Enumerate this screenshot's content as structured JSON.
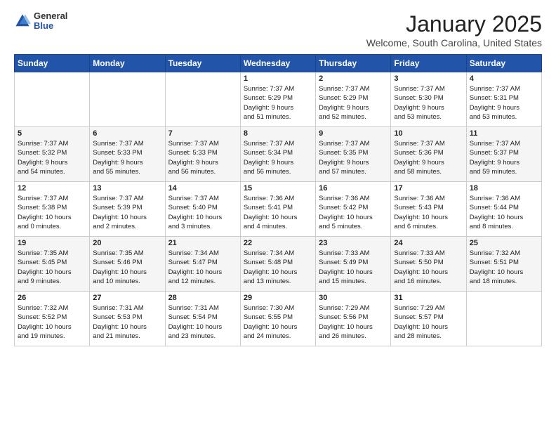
{
  "logo": {
    "general": "General",
    "blue": "Blue"
  },
  "title": "January 2025",
  "subtitle": "Welcome, South Carolina, United States",
  "headers": [
    "Sunday",
    "Monday",
    "Tuesday",
    "Wednesday",
    "Thursday",
    "Friday",
    "Saturday"
  ],
  "weeks": [
    [
      {
        "day": "",
        "info": ""
      },
      {
        "day": "",
        "info": ""
      },
      {
        "day": "",
        "info": ""
      },
      {
        "day": "1",
        "info": "Sunrise: 7:37 AM\nSunset: 5:29 PM\nDaylight: 9 hours\nand 51 minutes."
      },
      {
        "day": "2",
        "info": "Sunrise: 7:37 AM\nSunset: 5:29 PM\nDaylight: 9 hours\nand 52 minutes."
      },
      {
        "day": "3",
        "info": "Sunrise: 7:37 AM\nSunset: 5:30 PM\nDaylight: 9 hours\nand 53 minutes."
      },
      {
        "day": "4",
        "info": "Sunrise: 7:37 AM\nSunset: 5:31 PM\nDaylight: 9 hours\nand 53 minutes."
      }
    ],
    [
      {
        "day": "5",
        "info": "Sunrise: 7:37 AM\nSunset: 5:32 PM\nDaylight: 9 hours\nand 54 minutes."
      },
      {
        "day": "6",
        "info": "Sunrise: 7:37 AM\nSunset: 5:33 PM\nDaylight: 9 hours\nand 55 minutes."
      },
      {
        "day": "7",
        "info": "Sunrise: 7:37 AM\nSunset: 5:33 PM\nDaylight: 9 hours\nand 56 minutes."
      },
      {
        "day": "8",
        "info": "Sunrise: 7:37 AM\nSunset: 5:34 PM\nDaylight: 9 hours\nand 56 minutes."
      },
      {
        "day": "9",
        "info": "Sunrise: 7:37 AM\nSunset: 5:35 PM\nDaylight: 9 hours\nand 57 minutes."
      },
      {
        "day": "10",
        "info": "Sunrise: 7:37 AM\nSunset: 5:36 PM\nDaylight: 9 hours\nand 58 minutes."
      },
      {
        "day": "11",
        "info": "Sunrise: 7:37 AM\nSunset: 5:37 PM\nDaylight: 9 hours\nand 59 minutes."
      }
    ],
    [
      {
        "day": "12",
        "info": "Sunrise: 7:37 AM\nSunset: 5:38 PM\nDaylight: 10 hours\nand 0 minutes."
      },
      {
        "day": "13",
        "info": "Sunrise: 7:37 AM\nSunset: 5:39 PM\nDaylight: 10 hours\nand 2 minutes."
      },
      {
        "day": "14",
        "info": "Sunrise: 7:37 AM\nSunset: 5:40 PM\nDaylight: 10 hours\nand 3 minutes."
      },
      {
        "day": "15",
        "info": "Sunrise: 7:36 AM\nSunset: 5:41 PM\nDaylight: 10 hours\nand 4 minutes."
      },
      {
        "day": "16",
        "info": "Sunrise: 7:36 AM\nSunset: 5:42 PM\nDaylight: 10 hours\nand 5 minutes."
      },
      {
        "day": "17",
        "info": "Sunrise: 7:36 AM\nSunset: 5:43 PM\nDaylight: 10 hours\nand 6 minutes."
      },
      {
        "day": "18",
        "info": "Sunrise: 7:36 AM\nSunset: 5:44 PM\nDaylight: 10 hours\nand 8 minutes."
      }
    ],
    [
      {
        "day": "19",
        "info": "Sunrise: 7:35 AM\nSunset: 5:45 PM\nDaylight: 10 hours\nand 9 minutes."
      },
      {
        "day": "20",
        "info": "Sunrise: 7:35 AM\nSunset: 5:46 PM\nDaylight: 10 hours\nand 10 minutes."
      },
      {
        "day": "21",
        "info": "Sunrise: 7:34 AM\nSunset: 5:47 PM\nDaylight: 10 hours\nand 12 minutes."
      },
      {
        "day": "22",
        "info": "Sunrise: 7:34 AM\nSunset: 5:48 PM\nDaylight: 10 hours\nand 13 minutes."
      },
      {
        "day": "23",
        "info": "Sunrise: 7:33 AM\nSunset: 5:49 PM\nDaylight: 10 hours\nand 15 minutes."
      },
      {
        "day": "24",
        "info": "Sunrise: 7:33 AM\nSunset: 5:50 PM\nDaylight: 10 hours\nand 16 minutes."
      },
      {
        "day": "25",
        "info": "Sunrise: 7:32 AM\nSunset: 5:51 PM\nDaylight: 10 hours\nand 18 minutes."
      }
    ],
    [
      {
        "day": "26",
        "info": "Sunrise: 7:32 AM\nSunset: 5:52 PM\nDaylight: 10 hours\nand 19 minutes."
      },
      {
        "day": "27",
        "info": "Sunrise: 7:31 AM\nSunset: 5:53 PM\nDaylight: 10 hours\nand 21 minutes."
      },
      {
        "day": "28",
        "info": "Sunrise: 7:31 AM\nSunset: 5:54 PM\nDaylight: 10 hours\nand 23 minutes."
      },
      {
        "day": "29",
        "info": "Sunrise: 7:30 AM\nSunset: 5:55 PM\nDaylight: 10 hours\nand 24 minutes."
      },
      {
        "day": "30",
        "info": "Sunrise: 7:29 AM\nSunset: 5:56 PM\nDaylight: 10 hours\nand 26 minutes."
      },
      {
        "day": "31",
        "info": "Sunrise: 7:29 AM\nSunset: 5:57 PM\nDaylight: 10 hours\nand 28 minutes."
      },
      {
        "day": "",
        "info": ""
      }
    ]
  ]
}
